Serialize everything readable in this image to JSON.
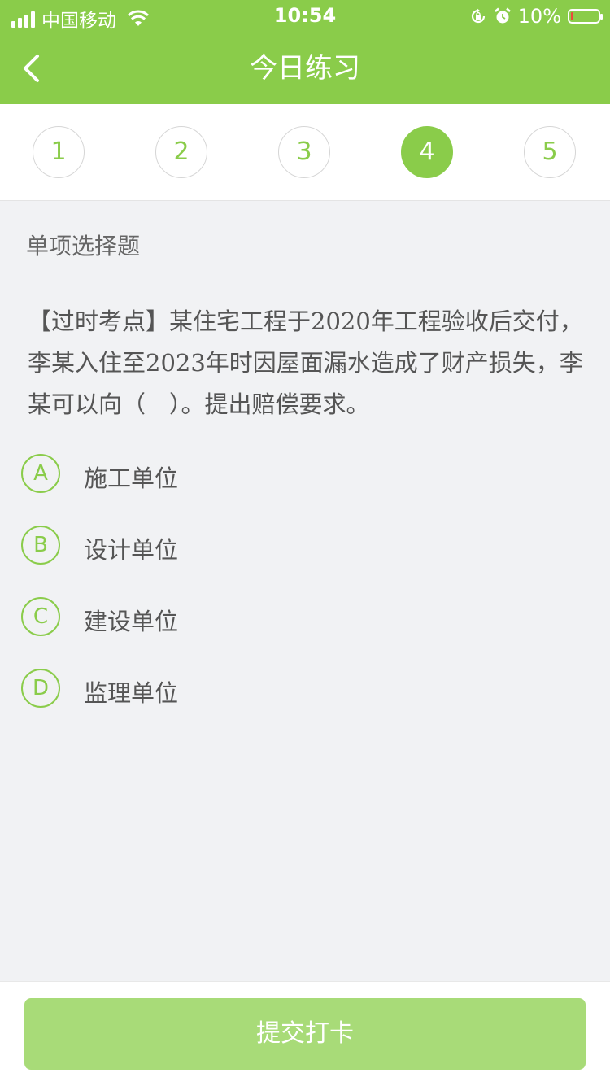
{
  "status_bar": {
    "carrier": "中国移动",
    "time": "10:54",
    "battery_text": "10%",
    "battery_level": 0.1,
    "battery_color": "#e94b3c"
  },
  "colors": {
    "accent": "#8acc4a",
    "button_disabled": "#a8db78"
  },
  "header": {
    "title": "今日练习",
    "back_icon": "chevron-left-icon"
  },
  "question_nav": {
    "items": [
      "1",
      "2",
      "3",
      "4",
      "5"
    ],
    "active_index": 3
  },
  "question": {
    "type_label": "单项选择题",
    "text": "【过时考点】某住宅工程于2020年工程验收后交付，李某入住至2023年时因屋面漏水造成了财产损失，李某可以向（　）。提出赔偿要求。",
    "options": [
      {
        "letter": "A",
        "text": "施工单位"
      },
      {
        "letter": "B",
        "text": "设计单位"
      },
      {
        "letter": "C",
        "text": "建设单位"
      },
      {
        "letter": "D",
        "text": "监理单位"
      }
    ]
  },
  "footer": {
    "submit_label": "提交打卡"
  }
}
